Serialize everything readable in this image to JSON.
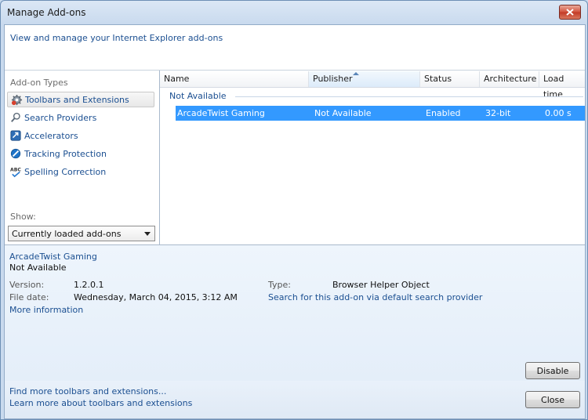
{
  "window": {
    "title": "Manage Add-ons"
  },
  "header": {
    "text": "View and manage your Internet Explorer add-ons"
  },
  "left": {
    "types_label": "Add-on Types",
    "items": [
      {
        "label": "Toolbars and Extensions",
        "icon": "gear-icon",
        "selected": true
      },
      {
        "label": "Search Providers",
        "icon": "search-icon",
        "selected": false
      },
      {
        "label": "Accelerators",
        "icon": "accelerator-icon",
        "selected": false
      },
      {
        "label": "Tracking Protection",
        "icon": "no-entry-icon",
        "selected": false
      },
      {
        "label": "Spelling Correction",
        "icon": "spellcheck-icon",
        "selected": false
      }
    ],
    "show_label": "Show:",
    "show_value": "Currently loaded add-ons"
  },
  "list": {
    "columns": [
      "Name",
      "Publisher",
      "Status",
      "Architecture",
      "Load time"
    ],
    "sorted_column": "Publisher",
    "group": "Not Available",
    "rows": [
      {
        "name": "ArcadeTwist Gaming",
        "publisher": "Not Available",
        "status": "Enabled",
        "arch": "32-bit",
        "load": "0.00 s"
      }
    ]
  },
  "details": {
    "name": "ArcadeTwist Gaming",
    "publisher": "Not Available",
    "version_label": "Version:",
    "version": "1.2.0.1",
    "date_label": "File date:",
    "date": "Wednesday, March 04, 2015, 3:12 AM",
    "type_label": "Type:",
    "type": "Browser Helper Object",
    "search_link": "Search for this add-on via default search provider",
    "more_info": "More information"
  },
  "buttons": {
    "disable": "Disable",
    "close": "Close"
  },
  "footer": {
    "link1": "Find more toolbars and extensions...",
    "link2": "Learn more about toolbars and extensions"
  },
  "colors": {
    "accent": "#1b4f91",
    "selection": "#3399ff"
  }
}
